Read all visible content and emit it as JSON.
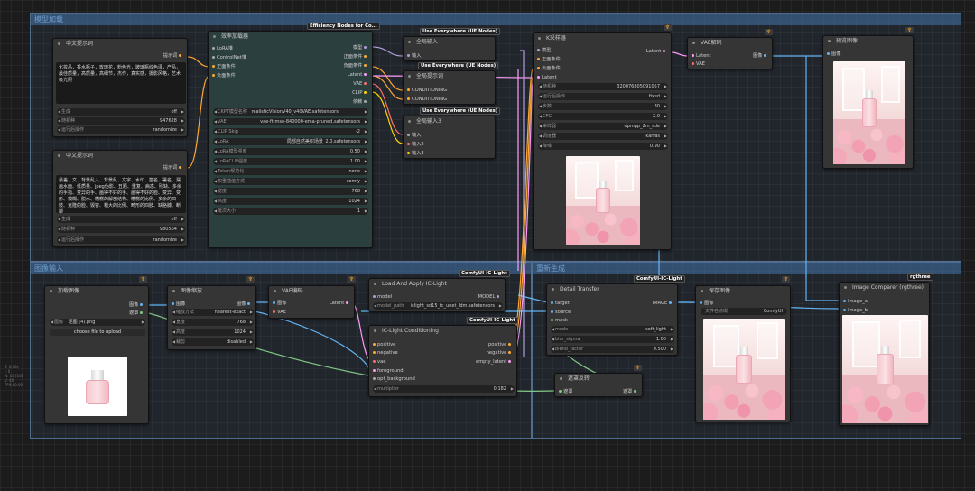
{
  "groups": [
    "模型加载",
    "图像输入",
    "重新生成"
  ],
  "nodes": {
    "prompt_cn_1": {
      "title": "中文提示词",
      "out": "提示词",
      "text": "化妆品，香水瓶子，玫瑰花，粉色光，玻璃瓶纹色泽，产品，最佳质量，高质量，高细节，杰作，真实感，摄影风格，艺术级光照",
      "w1l": "生成",
      "w1v": "off",
      "w2l": "随机种",
      "w2v": "947628",
      "w3l": "运行后操作",
      "w3v": "randomize"
    },
    "prompt_cn_2": {
      "title": "中文提示词",
      "out": "提示词",
      "text": "最差、文、背景乱入、背景乱、文字、水印、签名、署名、漏画水面、低质量、jpeg伪影、丑陋、重复、病态、残缺、多余的手指、变异的手、画得不好的手、画得不好的脸、变异、变形、模糊、脱水、糟糕的解剖结构、糟糕的比例、多余的四肢、克隆的脸、毁容、粗大的比例、畸形的四肢、缺胳膊、断腿",
      "w1l": "生成",
      "w1v": "off",
      "w2l": "随机种",
      "w2v": "980564",
      "w3l": "运行后操作",
      "w3v": "randomize"
    },
    "loader": {
      "badge": "Efficiency Nodes for Co...",
      "title": "效率加载器",
      "inputs": [
        "LoRA堆",
        "ControlNet堆",
        "正面条件",
        "负面条件"
      ],
      "outputs": [
        "模型",
        "正面条件",
        "负面条件",
        "Latent",
        "VAE",
        "CLIP",
        "依赖"
      ],
      "widgets": [
        [
          "CKPT模型名称",
          "realisticVisionV40_v40VAE.safetensors"
        ],
        [
          "VAE",
          "vae-ft-mse-840000-ema-pruned.safetensors"
        ],
        [
          "CLIP Skip",
          "-2"
        ],
        [
          "LoRA",
          "局部自然美织场景_2.0.safetensors"
        ],
        [
          "LoRA模型强度",
          "0.50"
        ],
        [
          "LoRACLIP强度",
          "1.00"
        ],
        [
          "Token规范化",
          "none"
        ],
        [
          "权重插值方式",
          "comfy"
        ],
        [
          "宽度",
          "768"
        ],
        [
          "高度",
          "1024"
        ],
        [
          "批次大小",
          "1"
        ]
      ]
    },
    "ue1": {
      "badge": "Use Everywhere (UE Nodes)",
      "title": "全局输入",
      "in": "输入"
    },
    "ue2": {
      "badge": "Use Everywhere (UE Nodes)",
      "title": "全局提示词",
      "in1": "CONDITIONING",
      "in2": "CONDITIONING"
    },
    "ue3": {
      "badge": "Use Everywhere (UE Nodes)",
      "title": "全局输入3",
      "in1": "输入",
      "in2": "输入2",
      "in3": "输入3"
    },
    "ksampler": {
      "title": "K采样器",
      "inputs": [
        "模型",
        "正面条件",
        "负面条件",
        "Latent"
      ],
      "out": "Latent",
      "widgets": [
        [
          "随机种",
          "320076805091057"
        ],
        [
          "运行后操作",
          "fixed"
        ],
        [
          "步数",
          "30"
        ],
        [
          "CFG",
          "2.0"
        ],
        [
          "采样器",
          "dpmpp_2m_sde"
        ],
        [
          "调度器",
          "karras"
        ],
        [
          "降噪",
          "0.90"
        ]
      ]
    },
    "vaedecode": {
      "title": "VAE解码",
      "in1": "Latent",
      "in2": "VAE",
      "out": "图像"
    },
    "preview": {
      "title": "预览图像",
      "in": "图像"
    },
    "loadimg": {
      "title": "加载图像",
      "out1": "图像",
      "out2": "遮罩",
      "w1l": "图像",
      "w1v": "泥图 (4).png",
      "upload": "choose file to upload"
    },
    "scale": {
      "title": "图像缩放",
      "in": "图像",
      "out": "图像",
      "widgets": [
        [
          "缩放方法",
          "nearest-exact"
        ],
        [
          "宽度",
          "768"
        ],
        [
          "高度",
          "1024"
        ],
        [
          "裁剪",
          "disabled"
        ]
      ]
    },
    "vaeencode": {
      "title": "VAE编码",
      "in1": "图像",
      "in2": "VAE",
      "out": "Latent"
    },
    "iclight_load": {
      "badge": "ComfyUI-IC-Light",
      "title": "Load And Apply IC-Light",
      "in": "model",
      "out": "MODEL",
      "w1l": "model_path",
      "w1v": "iclight_sd15_fc_unet_ldm.safetensors"
    },
    "iclight_cond": {
      "badge": "ComfyUI-IC-Light",
      "title": "IC-Light Conditioning",
      "inputs": [
        "positive",
        "negative",
        "vae",
        "foreground",
        "opt_background"
      ],
      "outputs": [
        "positive",
        "negative",
        "empty_latent"
      ],
      "w1l": "multiplier",
      "w1v": "0.182"
    },
    "detail": {
      "badge": "ComfyUI-IC-Light",
      "title": "Detail Transfer",
      "inputs": [
        "target",
        "source",
        "mask"
      ],
      "out": "IMAGE",
      "widgets": [
        [
          "mode",
          "soft_light"
        ],
        [
          "blur_sigma",
          "1.00"
        ],
        [
          "blend_factor",
          "0.500"
        ]
      ]
    },
    "maskinv": {
      "title": "遮罩反转",
      "in": "遮罩",
      "out": "遮罩"
    },
    "save": {
      "title": "保存图像",
      "in": "图像",
      "w1l": "文件名前缀",
      "w1v": "ComfyUI"
    },
    "comparer": {
      "badge": "rgthree",
      "title": "Image Comparer (rgthree)",
      "in1": "image_a",
      "in2": "image_b"
    }
  },
  "sidebar_info": [
    "T: 0.00s",
    "I: 0",
    "N: 16 [16]",
    "V: 40",
    "FPS:60.00"
  ],
  "colors": {
    "model": "#b39ddb",
    "cond": "#ffa931",
    "latent": "#ff9cf9",
    "vae": "#ff6e6e",
    "clip": "#ffd500",
    "image": "#64b5f6",
    "mask": "#81c784"
  }
}
